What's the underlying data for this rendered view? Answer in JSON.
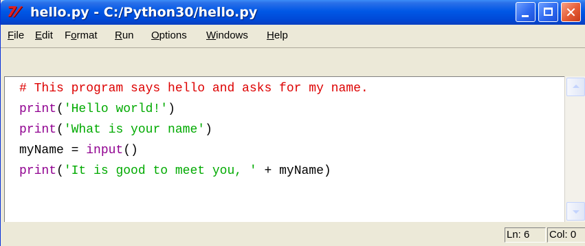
{
  "window": {
    "title": "hello.py - C:/Python30/hello.py",
    "app_icon_glyph": "7⁄",
    "title_icon": "idle-app-icon",
    "buttons": {
      "minimize_icon": "minimize-icon",
      "maximize_icon": "maximize-icon",
      "close_icon": "close-icon",
      "close_glyph": "✕"
    }
  },
  "menu": {
    "file": {
      "hot": "F",
      "rest": "ile"
    },
    "edit": {
      "hot": "E",
      "rest": "dit"
    },
    "format": {
      "pre": "F",
      "hot": "o",
      "rest": "rmat"
    },
    "run": {
      "hot": "R",
      "rest": "un"
    },
    "options": {
      "hot": "O",
      "rest": "ptions"
    },
    "windows": {
      "hot": "W",
      "rest": "indows"
    },
    "help": {
      "hot": "H",
      "rest": "elp"
    }
  },
  "code": {
    "line1": {
      "comment": "# This program says hello and asks for my name."
    },
    "line2": {
      "builtin": "print",
      "open": "(",
      "string": "'Hello world!'",
      "close": ")"
    },
    "line3": {
      "builtin": "print",
      "open": "(",
      "string": "'What is your name'",
      "close": ")"
    },
    "line4": {
      "var": "myName = ",
      "builtin": "input",
      "call": "()"
    },
    "line5": {
      "builtin": "print",
      "open": "(",
      "string": "'It is good to meet you, '",
      "rest": " + myName)"
    }
  },
  "colors": {
    "comment": "#dd0000",
    "builtin": "#900090",
    "string": "#00aa00",
    "titlebar": "#0058e6",
    "close_button": "#e45c35"
  },
  "status": {
    "line": "Ln: 6",
    "column": "Col: 0"
  }
}
